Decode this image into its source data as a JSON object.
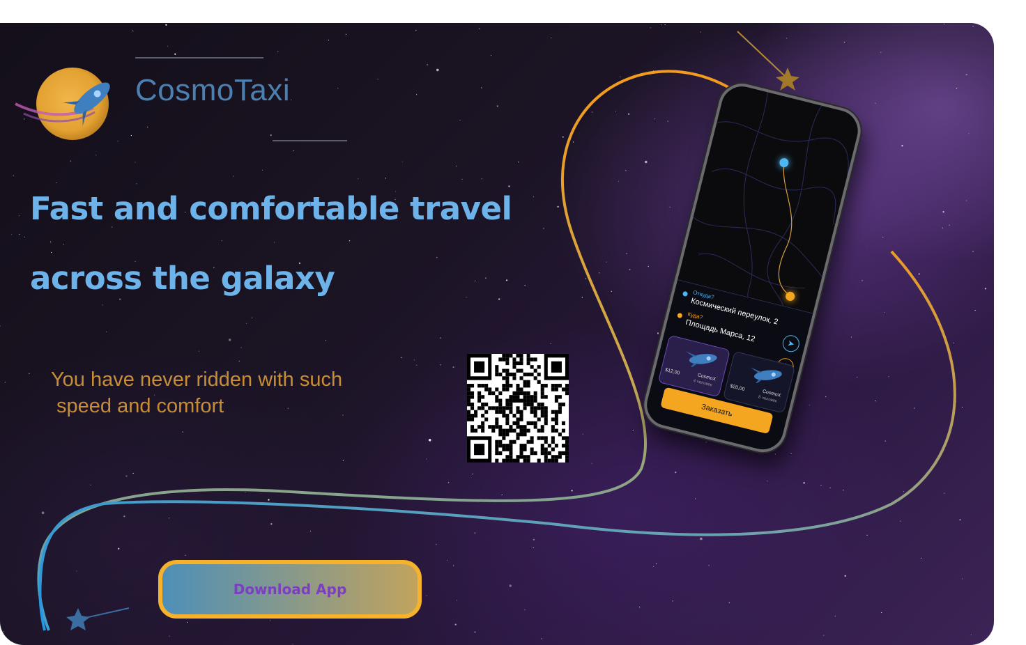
{
  "brand": {
    "name": "CosmoTaxi",
    "icon": "rocket-planet-logo"
  },
  "hero": {
    "headline_line1": "Fast and comfortable travel",
    "headline_line2": "across the galaxy",
    "subline_line1": "You have never ridden with such",
    "subline_line2": "speed and comfort"
  },
  "qr": {
    "icon": "qr-code"
  },
  "cta": {
    "download_label": "Download App"
  },
  "phone": {
    "from_label": "Откуда?",
    "from_value": "Космический переулок, 2",
    "to_label": "Куда?",
    "to_value": "Площадь Марса, 12",
    "rides": [
      {
        "price": "$12,00",
        "name": "CosmoX",
        "capacity": "4 человек"
      },
      {
        "price": "$20,00",
        "name": "CosmoX",
        "capacity": "8 человек"
      }
    ],
    "order_label": "Заказать"
  },
  "colors": {
    "accent_blue": "#6db3ea",
    "accent_orange": "#f6b22b",
    "button_text": "#7d3ec2",
    "subline": "#c88d35"
  }
}
